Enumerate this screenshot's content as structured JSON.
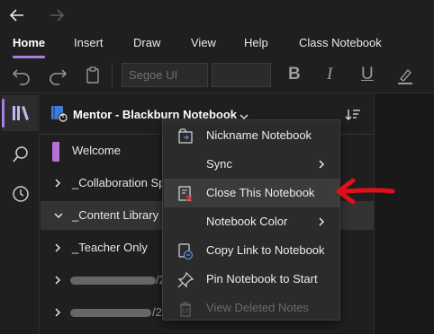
{
  "ribbon": {
    "tabs": [
      {
        "label": "Home"
      },
      {
        "label": "Insert"
      },
      {
        "label": "Draw"
      },
      {
        "label": "View"
      },
      {
        "label": "Help"
      },
      {
        "label": "Class Notebook"
      }
    ],
    "font_name": "Segoe UI",
    "bold": "B",
    "italic": "I",
    "underline": "U"
  },
  "notebook": {
    "title": "Mentor - Blackburn Notebook"
  },
  "sections": [
    {
      "label": "Welcome"
    },
    {
      "label": "_Collaboration Sp"
    },
    {
      "label": "_Content Library"
    },
    {
      "label": "_Teacher Only"
    },
    {
      "tail": "/2"
    },
    {
      "tail": "/2"
    }
  ],
  "context_menu": {
    "items": [
      {
        "label": "Nickname Notebook"
      },
      {
        "label": "Sync"
      },
      {
        "label": "Close This Notebook"
      },
      {
        "label": "Notebook Color"
      },
      {
        "label": "Copy Link to Notebook"
      },
      {
        "label": "Pin Notebook to Start"
      },
      {
        "label": "View Deleted Notes"
      }
    ]
  },
  "colors": {
    "accent": "#a47ee0",
    "section_welcome": "#b46fd9",
    "annotation_arrow": "#e0101a"
  },
  "icons": {
    "nav": [
      "back-arrow-icon",
      "forward-arrow-icon"
    ],
    "toolbar": [
      "undo-icon",
      "redo-icon",
      "clipboard-icon",
      "highlighter-icon"
    ],
    "rail": [
      "notebooks-icon",
      "search-icon",
      "recent-clock-icon"
    ],
    "menu": [
      "nickname-icon",
      "close-notebook-icon",
      "copy-link-icon",
      "pin-icon",
      "trash-icon"
    ]
  }
}
